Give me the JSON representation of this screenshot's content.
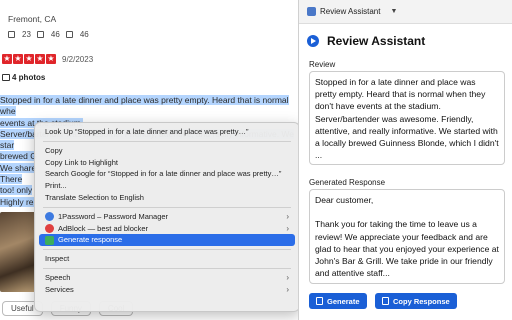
{
  "page": {
    "location": "Fremont, CA",
    "stats": [
      {
        "icon": "friends-icon",
        "value": "23"
      },
      {
        "icon": "reviews-icon",
        "value": "46"
      },
      {
        "icon": "photos-icon",
        "value": "46"
      }
    ],
    "rating": 5,
    "date": "9/2/2023",
    "photos_label": "4 photos",
    "review_lines": [
      "Stopped in for a late dinner and place was pretty empty. Heard that is normal whe",
      "events at the stadium.",
      "Server/bartender was awesome. Friendly, attentive, and really informative. We star",
      "brewed G",
      "We share",
      "There",
      "too! only",
      "Highly re"
    ],
    "buttons": [
      "Useful",
      "Funny",
      "Cool"
    ]
  },
  "menu": {
    "items": [
      {
        "label": "Look Up “Stopped in for a late dinner and place was pretty…”",
        "arrow": false
      },
      {
        "sep": true
      },
      {
        "label": "Copy",
        "arrow": false
      },
      {
        "label": "Copy Link to Highlight",
        "arrow": false
      },
      {
        "label": "Search Google for “Stopped in for a late dinner and place was pretty…”",
        "arrow": false
      },
      {
        "label": "Print...",
        "arrow": false
      },
      {
        "label": "Translate Selection to English",
        "arrow": false
      },
      {
        "sep": true
      },
      {
        "label": "1Password – Password Manager",
        "arrow": true,
        "icon": "1password-icon"
      },
      {
        "label": "AdBlock — best ad blocker",
        "arrow": true,
        "icon": "adblock-icon"
      },
      {
        "label": "Generate response",
        "arrow": false,
        "icon": "generate-icon",
        "highlight": true
      },
      {
        "sep": true
      },
      {
        "label": "Inspect",
        "arrow": false
      },
      {
        "sep": true
      },
      {
        "label": "Speech",
        "arrow": true
      },
      {
        "label": "Services",
        "arrow": true
      }
    ]
  },
  "panel": {
    "tab_label": "Review Assistant",
    "title": "Review Assistant",
    "review_label": "Review",
    "review_text": "Stopped in for a late dinner and place was pretty empty. Heard that is normal when they don't have events at the stadium. Server/bartender was awesome. Friendly, attentive, and really informative. We started with a locally brewed Guinness Blonde, which I didn't ...",
    "generated_label": "Generated Response",
    "generated_text": "Dear customer,\n\nThank you for taking the time to leave us a review! We appreciate your feedback and are glad to hear that you enjoyed your experience at John's Bar & Grill. We take pride in our friendly and attentive staff...",
    "generate_button": "Generate",
    "copy_button": "Copy Response"
  }
}
